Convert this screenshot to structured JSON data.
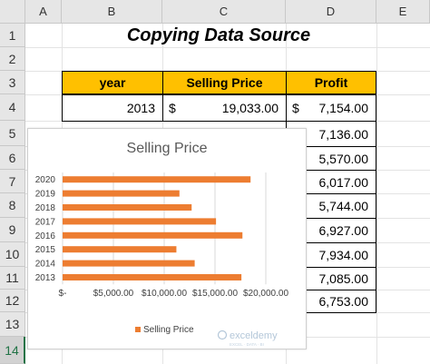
{
  "columns": [
    "A",
    "B",
    "C",
    "D",
    "E"
  ],
  "rows": [
    "1",
    "2",
    "3",
    "4",
    "5",
    "6",
    "7",
    "8",
    "9",
    "10",
    "11",
    "12",
    "13",
    "14"
  ],
  "selected_row": "14",
  "sheet_title": "Copying Data Source",
  "table": {
    "headers": [
      "year",
      "Selling Price",
      "Profit"
    ],
    "header_color": "#ffc000",
    "currency": "$",
    "first_row": {
      "year": "2013",
      "selling_price": "19,033.00",
      "profit": "7,154.00"
    },
    "profit_visible": [
      "7,136.00",
      "5,570.00",
      "6,017.00",
      "5,744.00",
      "6,927.00",
      "7,934.00",
      "7,085.00",
      "6,753.00"
    ]
  },
  "chart_data": {
    "type": "bar",
    "orientation": "horizontal",
    "title": "Selling Price",
    "categories": [
      "2020",
      "2019",
      "2018",
      "2017",
      "2016",
      "2015",
      "2014",
      "2013"
    ],
    "series": [
      {
        "name": "Selling Price",
        "color": "#ed7d31",
        "values": [
          18500,
          11500,
          12700,
          15100,
          17700,
          11200,
          13000,
          17600
        ]
      }
    ],
    "xlim": [
      0,
      20000
    ],
    "xticks": [
      "$-",
      "$5,000.00",
      "$10,000.00",
      "$15,000.00",
      "$20,000.00"
    ],
    "legend": "bottom",
    "grid": true
  },
  "watermark": {
    "brand": "exceldemy",
    "tagline": "EXCEL · DATA · BI"
  }
}
